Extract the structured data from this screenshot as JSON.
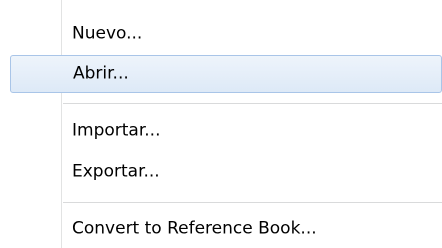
{
  "menu": {
    "items": [
      {
        "label": "Nuevo..."
      },
      {
        "label": "Abrir..."
      },
      {
        "label": "Importar..."
      },
      {
        "label": "Exportar..."
      },
      {
        "label": "Convert to Reference Book..."
      }
    ],
    "selected_label": "Abrir...",
    "colors": {
      "highlight_border": "#a9c5e8",
      "highlight_fill": "#dde9f7",
      "separator": "#d9dadb",
      "text": "#000000"
    }
  }
}
